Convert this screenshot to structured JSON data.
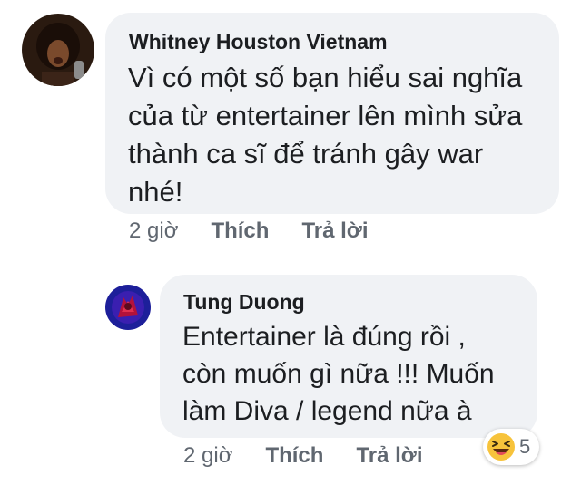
{
  "comments": [
    {
      "author": "Whitney Houston Vietnam",
      "lines": [
        "Vì có một số bạn hiểu sai nghĩa",
        "của từ entertainer lên mình sửa",
        "thành ca sĩ để tránh gây war",
        "nhé!"
      ],
      "time": "2 giờ",
      "like_label": "Thích",
      "reply_label": "Trả lời"
    }
  ],
  "replies": [
    {
      "author": "Tung Duong",
      "lines": [
        "Entertainer là đúng rồi ,",
        "còn muốn gì nữa !!! Muốn",
        "làm Diva / legend nữa à"
      ],
      "time": "2 giờ",
      "like_label": "Thích",
      "reply_label": "Trả lời",
      "reaction": {
        "icon": "laughing-emoji-icon",
        "count": "5"
      }
    }
  ]
}
